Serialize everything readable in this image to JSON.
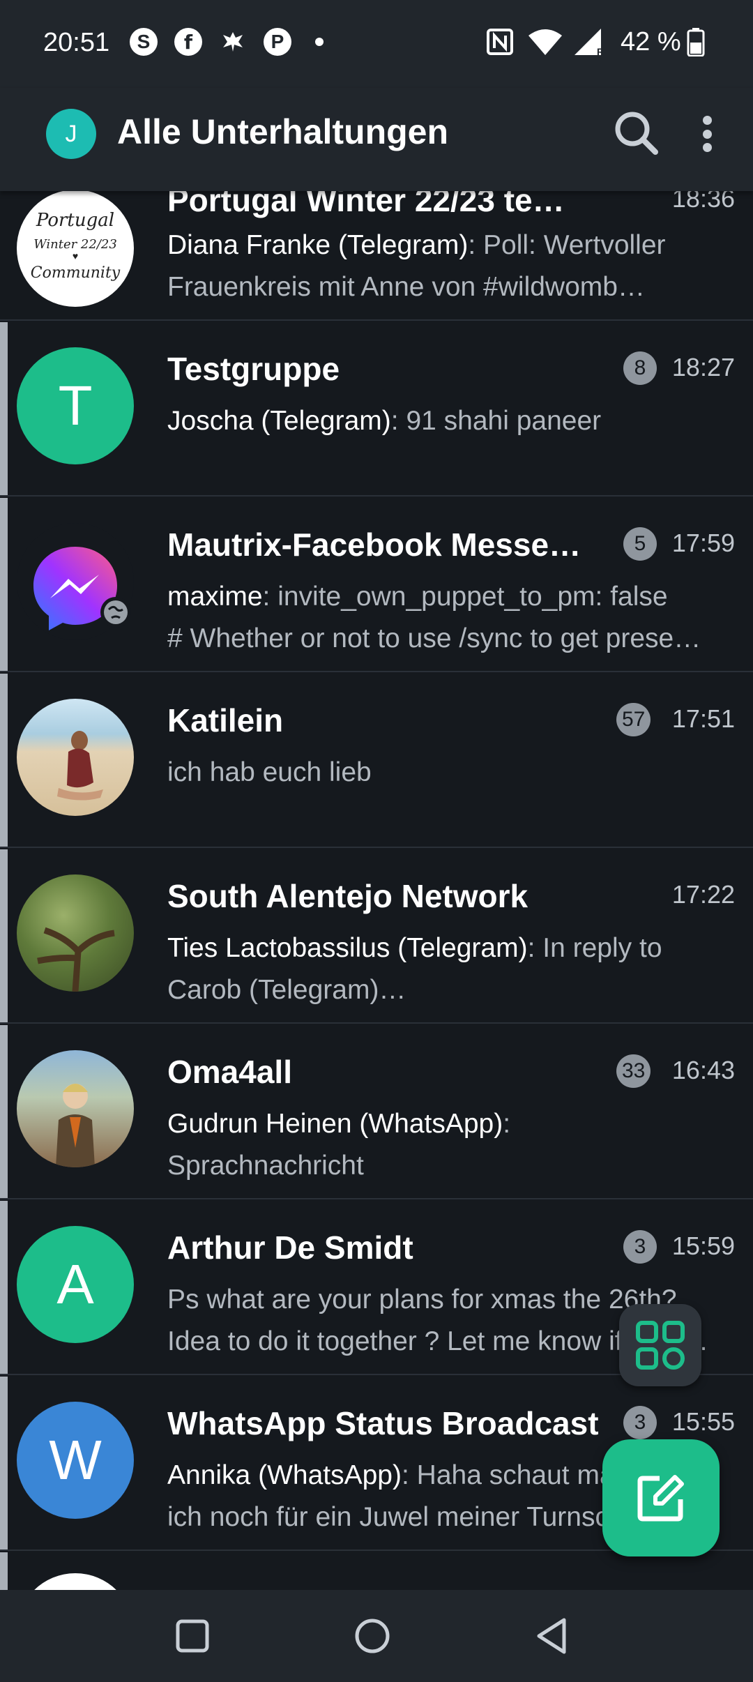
{
  "status_bar": {
    "time": "20:51",
    "battery": "42 %",
    "icons": [
      "skype-icon",
      "facebook-icon",
      "eagle-icon",
      "pinterest-icon",
      "more-dot-icon",
      "nfc-icon",
      "wifi-icon",
      "signal-icon",
      "battery-icon"
    ]
  },
  "app_bar": {
    "avatar_letter": "J",
    "title": "Alle Unterhaltungen"
  },
  "conversations": [
    {
      "title": "Portugal Winter 22/23 te…",
      "time": "18:36",
      "badge": "",
      "sender": "Diana Franke (Telegram)",
      "preview_1": ": Poll: Wertvoller",
      "preview_2": "Frauenkreis mit Anne von #wildwomb…",
      "avatar_text": "Portugal Winter 22/23 Community"
    },
    {
      "title": "Testgruppe",
      "time": "18:27",
      "badge": "8",
      "sender": "Joscha (Telegram)",
      "preview_1": ": 91 shahi paneer",
      "preview_2": "",
      "avatar_letter": "T"
    },
    {
      "title": "Mautrix-Facebook Messen…",
      "time": "17:59",
      "badge": "5",
      "sender": "maxime",
      "preview_1": ": invite_own_puppet_to_pm: false",
      "preview_2": "# Whether or not to use /sync to get prese…"
    },
    {
      "title": "Katilein",
      "time": "17:51",
      "badge": "57",
      "sender": "",
      "preview_1": "ich hab euch lieb",
      "preview_2": ""
    },
    {
      "title": "South Alentejo Network",
      "time": "17:22",
      "badge": "",
      "sender": "Ties Lactobassilus (Telegram)",
      "preview_1": ": In reply to",
      "preview_2": "Carob (Telegram)…"
    },
    {
      "title": "Oma4all",
      "time": "16:43",
      "badge": "33",
      "sender": " Gudrun Heinen  (WhatsApp)",
      "preview_1": ":",
      "preview_2": "Sprachnachricht"
    },
    {
      "title": "Arthur De Smidt",
      "time": "15:59",
      "badge": "3",
      "sender": "",
      "preview_1": "Ps what are your plans for xmas the 26th?",
      "preview_2": "Idea to do it together ? Let me know if you …",
      "avatar_letter": "A"
    },
    {
      "title": "WhatsApp Status Broadcast",
      "time": "15:55",
      "badge": "3",
      "sender": " Annika  (WhatsApp)",
      "preview_1": ": Haha schaut mal",
      "preview_2": "ich noch für ein Juwel meiner Turnschuhe…",
      "avatar_letter": "W"
    }
  ],
  "colors": {
    "background": "#15191e",
    "bar": "#21262c",
    "accent_green": "#1dbd8a",
    "accent_teal": "#1dbcb2",
    "avatar_blue": "#3a86d6",
    "badge": "#8f969e"
  }
}
